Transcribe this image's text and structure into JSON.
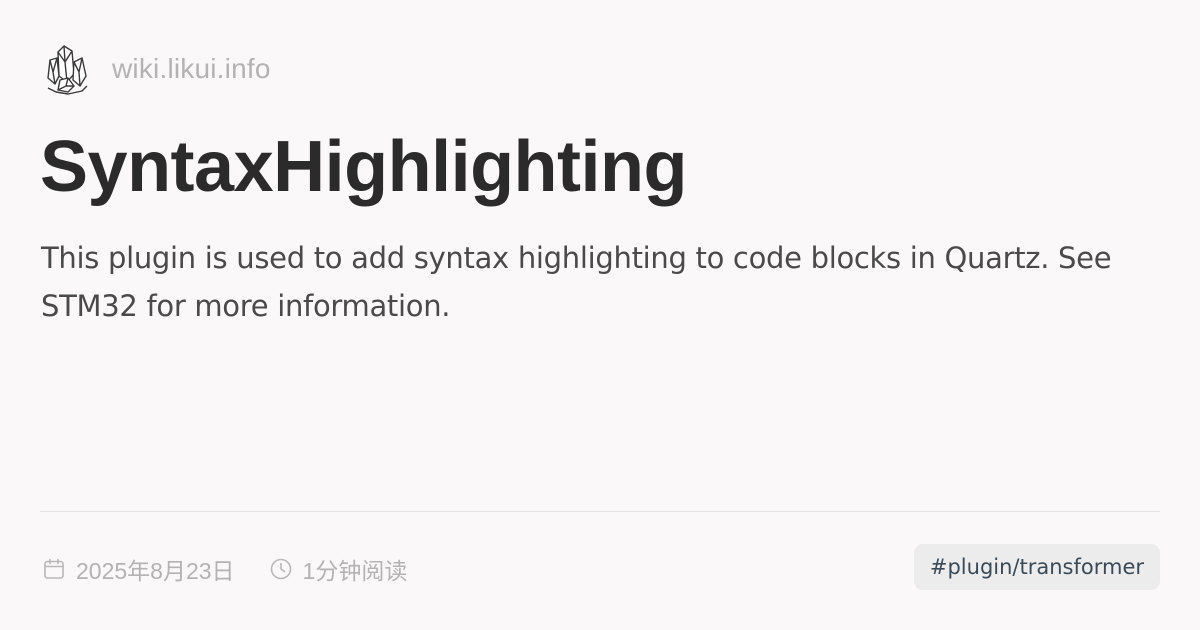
{
  "site": {
    "logo_icon": "crystal-cluster-icon",
    "name": "wiki.likui.info"
  },
  "title": "SyntaxHighlighting",
  "description": "This plugin is used to add syntax highlighting to code blocks in Quartz. See STM32 for more information.",
  "meta": {
    "date_icon": "calendar-icon",
    "date": "2025年8月23日",
    "reading_time_icon": "clock-icon",
    "reading_time": "1分钟阅读"
  },
  "tag": "#plugin/transformer",
  "colors": {
    "background": "#faf8f8",
    "title": "#2b2b2b",
    "description": "#4a4a4a",
    "muted": "#b3b3b3",
    "tag_bg": "#ececec",
    "tag_text": "#3b4a58"
  }
}
